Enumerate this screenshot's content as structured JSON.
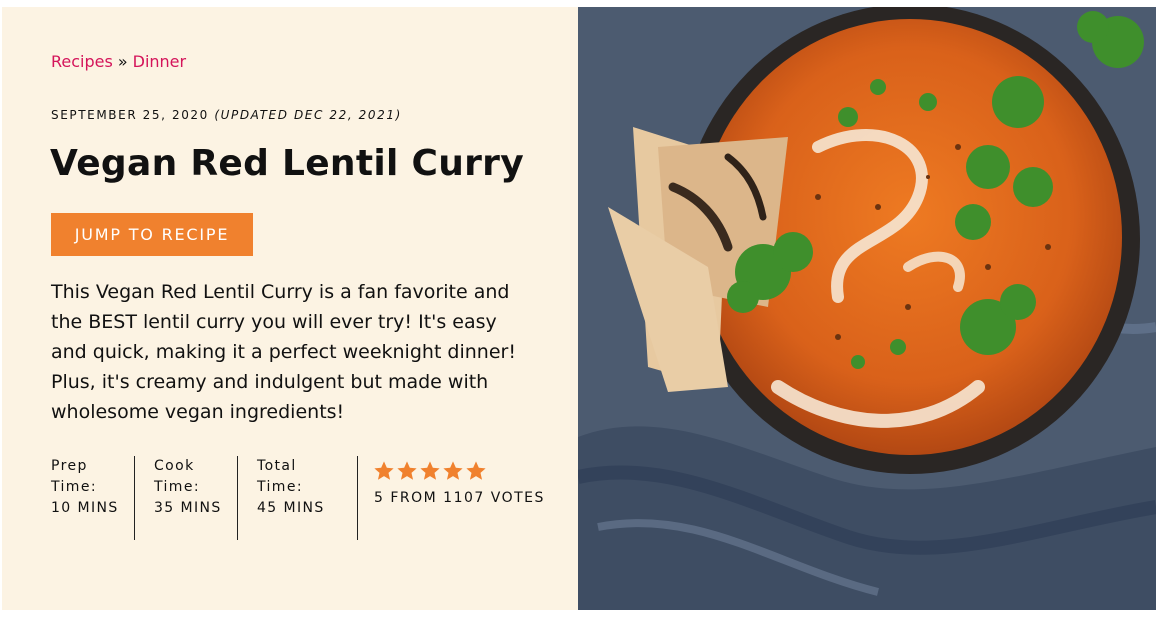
{
  "breadcrumb": {
    "items": [
      {
        "label": "Recipes"
      },
      {
        "label": "Dinner"
      }
    ],
    "separator": "»"
  },
  "post": {
    "date": "SEPTEMBER 25, 2020",
    "updated": "(UPDATED DEC 22, 2021)",
    "title": "Vegan Red Lentil Curry",
    "jump_label": "JUMP TO RECIPE",
    "description": "This Vegan Red Lentil Curry is a fan favorite and the BEST lentil curry you will ever try! It's easy and quick, making it a perfect weeknight dinner! Plus, it's creamy and indulgent but made with wholesome vegan ingredients!"
  },
  "times": {
    "prep": {
      "label": "Prep Time:",
      "value": "10 MINS"
    },
    "cook": {
      "label": "Cook Time:",
      "value": "35 MINS"
    },
    "total": {
      "label": "Total Time:",
      "value": "45 MINS"
    }
  },
  "rating": {
    "value": 5,
    "max": 5,
    "text": "5 FROM 1107 VOTES"
  },
  "photo": {
    "alt": "Vegan Red Lentil Curry"
  },
  "colors": {
    "background": "#fcf3e3",
    "accent": "#f0812e",
    "link": "#d4145a",
    "text": "#111111"
  }
}
